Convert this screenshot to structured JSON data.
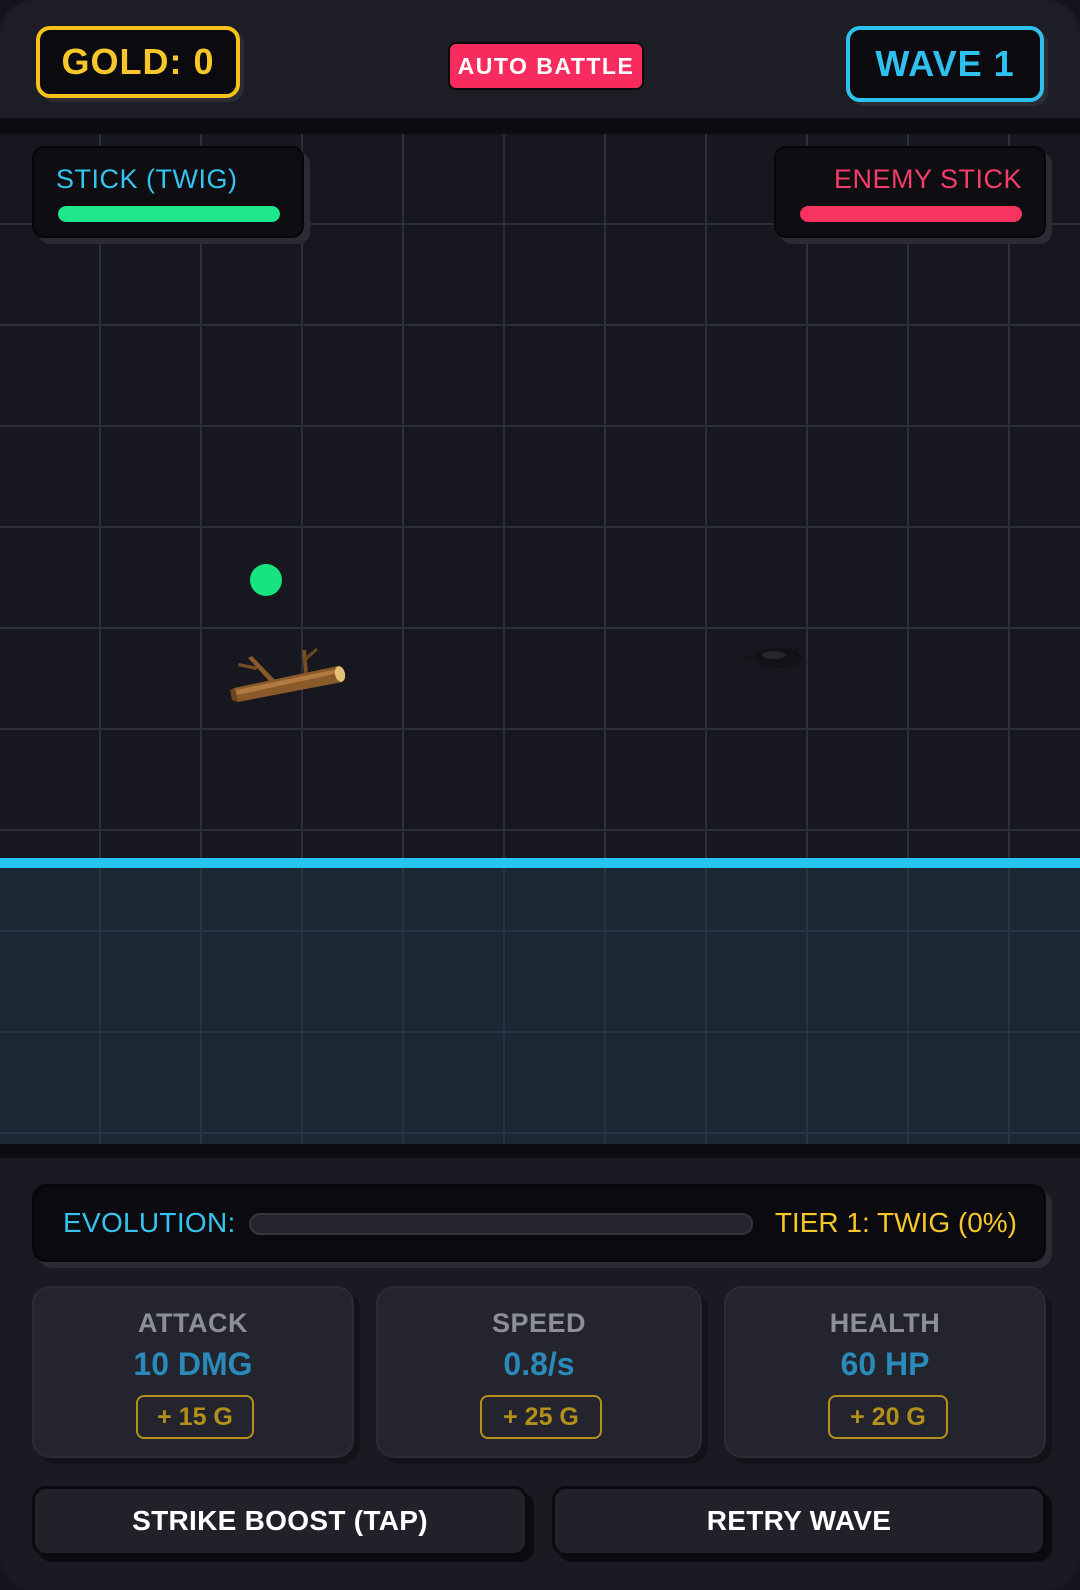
{
  "hud": {
    "gold_label": "GOLD: 0",
    "auto_battle_label": "AUTO BATTLE",
    "wave_label": "WAVE 1"
  },
  "arena": {
    "player": {
      "name": "STICK (TWIG)",
      "hp_percent": 100,
      "hp_color": "#1fe88c"
    },
    "enemy": {
      "name": "ENEMY STICK",
      "hp_percent": 100,
      "hp_color": "#f7335f"
    },
    "ground_color": "#29c3f1"
  },
  "evolution": {
    "label": "EVOLUTION:",
    "progress_percent": 0,
    "tier_label": "TIER 1: TWIG (0%)"
  },
  "upgrades": [
    {
      "title": "ATTACK",
      "value": "10 DMG",
      "cost": "+ 15 G"
    },
    {
      "title": "SPEED",
      "value": "0.8/s",
      "cost": "+ 25 G"
    },
    {
      "title": "HEALTH",
      "value": "60 HP",
      "cost": "+ 20 G"
    }
  ],
  "actions": {
    "strike_boost_label": "STRIKE BOOST (TAP)",
    "retry_wave_label": "RETRY WAVE"
  },
  "colors": {
    "gold": "#f7c62a",
    "accent_blue": "#2ec0ee",
    "accent_red": "#f72b5d"
  }
}
